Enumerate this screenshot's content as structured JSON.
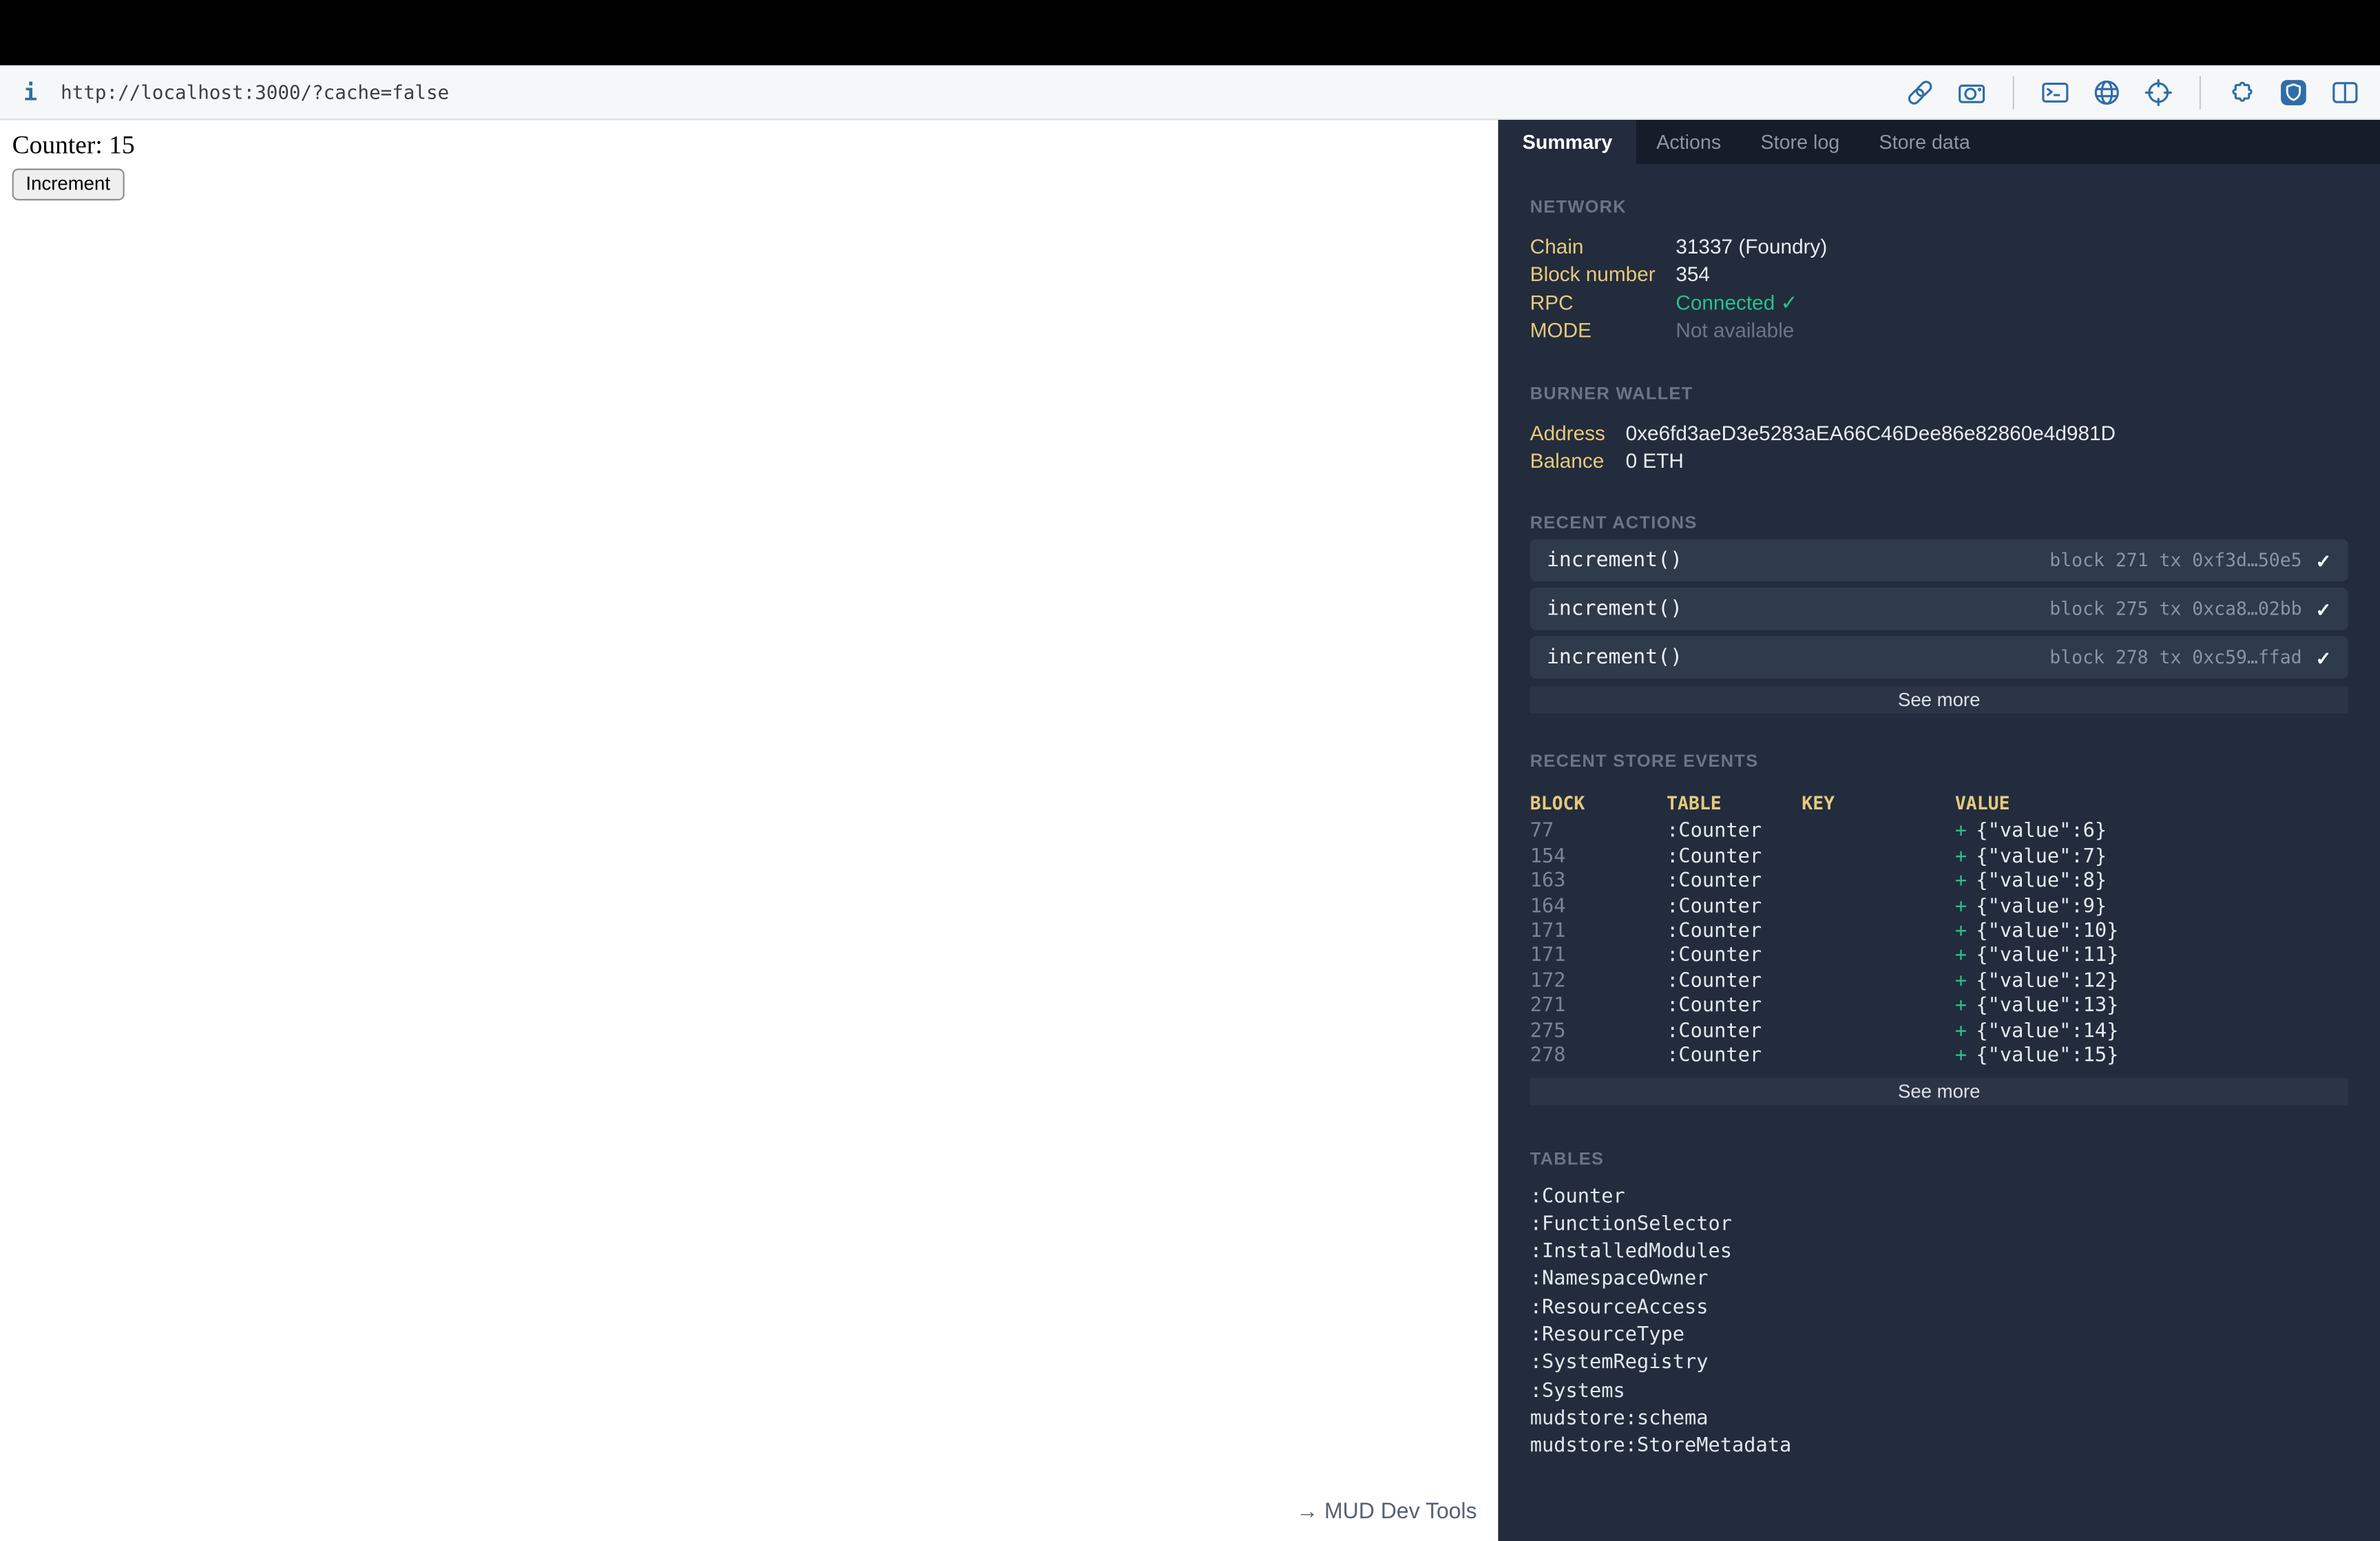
{
  "browser": {
    "url": "http://localhost:3000/?cache=false",
    "info_glyph": "i",
    "toolbar_icons": [
      "link-icon",
      "camera-icon",
      "terminal-icon",
      "globe-icon",
      "target-icon",
      "puzzle-icon",
      "shield-icon",
      "split-view-icon"
    ]
  },
  "page": {
    "counter": "Counter: 15",
    "increment_button": "Increment",
    "devtools_toggle": "→ MUD Dev Tools"
  },
  "devtools": {
    "tabs": [
      {
        "label": "Summary"
      },
      {
        "label": "Actions"
      },
      {
        "label": "Store log"
      },
      {
        "label": "Store data"
      }
    ],
    "network": {
      "title": "NETWORK",
      "rows": [
        {
          "label": "Chain",
          "value": "31337 (Foundry)"
        },
        {
          "label": "Block number",
          "value": "354"
        },
        {
          "label": "RPC",
          "value": "Connected ✓"
        },
        {
          "label": "MODE",
          "value": "Not available"
        }
      ]
    },
    "burner_wallet": {
      "title": "BURNER WALLET",
      "rows": [
        {
          "label": "Address",
          "value": "0xe6fd3aeD3e5283aEA66C46Dee86e82860e4d981D"
        },
        {
          "label": "Balance",
          "value": "0 ETH"
        }
      ]
    },
    "recent_actions": {
      "title": "RECENT ACTIONS",
      "items": [
        {
          "name": "increment()",
          "meta": "block 271 tx 0xf3d…50e5",
          "check": "✓"
        },
        {
          "name": "increment()",
          "meta": "block 275 tx 0xca8…02bb",
          "check": "✓"
        },
        {
          "name": "increment()",
          "meta": "block 278 tx 0xc59…ffad",
          "check": "✓"
        }
      ],
      "see_more": "See more"
    },
    "recent_store_events": {
      "title": "RECENT STORE EVENTS",
      "columns": {
        "block": "BLOCK",
        "table": "TABLE",
        "key": "KEY",
        "value": "VALUE"
      },
      "plus": "+",
      "rows": [
        {
          "block": "77",
          "table": ":Counter",
          "key": "",
          "value": "{\"value\":6}"
        },
        {
          "block": "154",
          "table": ":Counter",
          "key": "",
          "value": "{\"value\":7}"
        },
        {
          "block": "163",
          "table": ":Counter",
          "key": "",
          "value": "{\"value\":8}"
        },
        {
          "block": "164",
          "table": ":Counter",
          "key": "",
          "value": "{\"value\":9}"
        },
        {
          "block": "171",
          "table": ":Counter",
          "key": "",
          "value": "{\"value\":10}"
        },
        {
          "block": "171",
          "table": ":Counter",
          "key": "",
          "value": "{\"value\":11}"
        },
        {
          "block": "172",
          "table": ":Counter",
          "key": "",
          "value": "{\"value\":12}"
        },
        {
          "block": "271",
          "table": ":Counter",
          "key": "",
          "value": "{\"value\":13}"
        },
        {
          "block": "275",
          "table": ":Counter",
          "key": "",
          "value": "{\"value\":14}"
        },
        {
          "block": "278",
          "table": ":Counter",
          "key": "",
          "value": "{\"value\":15}"
        }
      ],
      "see_more": "See more"
    },
    "tables": {
      "title": "TABLES",
      "items": [
        ":Counter",
        ":FunctionSelector",
        ":InstalledModules",
        ":NamespaceOwner",
        ":ResourceAccess",
        ":ResourceType",
        ":SystemRegistry",
        ":Systems",
        "mudstore:schema",
        "mudstore:StoreMetadata"
      ]
    }
  },
  "colors": {
    "accent_yellow": "#e7c97d",
    "success_green": "#2abf8d",
    "icon_blue": "#2e6da7",
    "panel_bg": "#222c3c",
    "tabbar_bg": "#151d2b",
    "row_bg": "#2f3a4b"
  }
}
